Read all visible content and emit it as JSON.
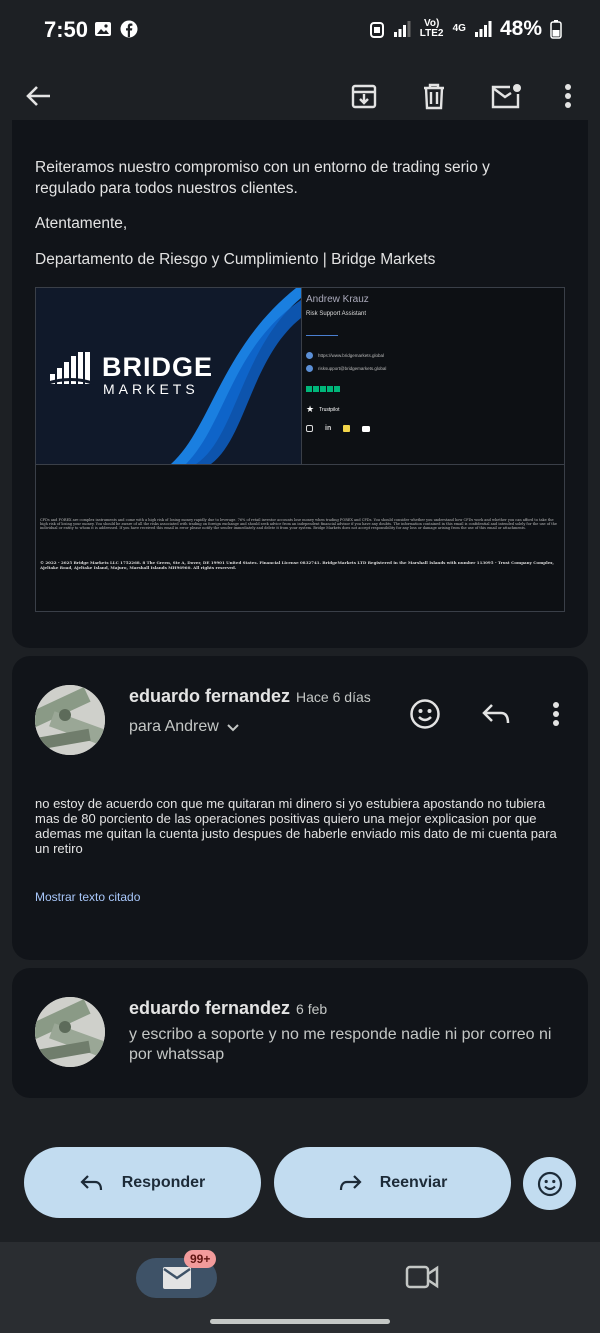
{
  "status_bar": {
    "time": "7:50",
    "network": "Vo) LTE2",
    "network_gen": "4G",
    "battery": "48%"
  },
  "toolbar": {
    "back_icon": "arrow-left-icon",
    "archive_icon": "archive-icon",
    "delete_icon": "trash-icon",
    "unread_icon": "mark-unread-icon",
    "more_icon": "more-vert-icon"
  },
  "message1": {
    "para1": "Reiteramos nuestro compromiso con un entorno de trading serio y regulado para todos nuestros clientes.",
    "closing": "Atentamente,",
    "signoff": "Departamento de Riesgo y Cumplimiento | Bridge Markets",
    "signature": {
      "logo_top": "BRIDGE",
      "logo_bottom": "MARKETS",
      "name": "Andrew Krauz",
      "role": "Risk Support Assistant",
      "website": "https://www.bridgemarkets.global",
      "email": "risksupport@bridgemarkets.global",
      "trustpilot_label": "Trustpilot",
      "disclaimer": "CFDs and FOREX are complex instruments and come with a high risk of losing money rapidly due to leverage. 76% of retail investor accounts lose money when trading FOREX and CFDs. You should consider whether you understand how CFDs work and whether you can afford to take the high risk of losing your money. You should be aware of all the risks associated with trading on foreign exchange and should seek advice from an independent financial advisor if you have any doubts. The information contained in this email is confidential and intended solely for the use of the individual or entity to whom it is addressed. If you have received this email in error please notify the sender immediately and delete it from your system. Bridge Markets does not accept responsibility for any loss or damage arising from the use of this email or attachments.",
      "copyright": "© 2022 - 2025 Bridge Markets LLC 1752268. 8 The Green, Ste A, Dover, DE 19901 United States. Financial License 0832741. BridgeMarkets LTD Registered in the Marshall Islands with number 113095 - Trust Company Complex, Ajeltake Road, Ajeltake Island, Majuro, Marshall Islands MH96960. All rights reserved."
    }
  },
  "message2": {
    "sender": "eduardo fernandez",
    "time": "Hace 6 días",
    "to": "para Andrew",
    "body": "no estoy de acuerdo con que me quitaran mi dinero si yo estubiera apostando no tubiera mas de 80 porciento de las operaciones positivas quiero una mejor explicasion por que ademas me quitan la cuenta justo despues de haberle enviado mis dato de mi cuenta para un retiro",
    "show_quoted": "Mostrar texto citado"
  },
  "message3": {
    "sender": "eduardo fernandez",
    "time": "6 feb",
    "snippet": "y escribo a soporte y no me responde nadie ni por correo ni por whatssap"
  },
  "actions": {
    "reply": "Responder",
    "forward": "Reenviar"
  },
  "nav": {
    "mail_badge": "99+"
  },
  "colors": {
    "background": "#1d2024",
    "card": "#111419",
    "button": "#c2dcf0",
    "link": "#a8c7fa",
    "badge": "#f29b9b"
  }
}
